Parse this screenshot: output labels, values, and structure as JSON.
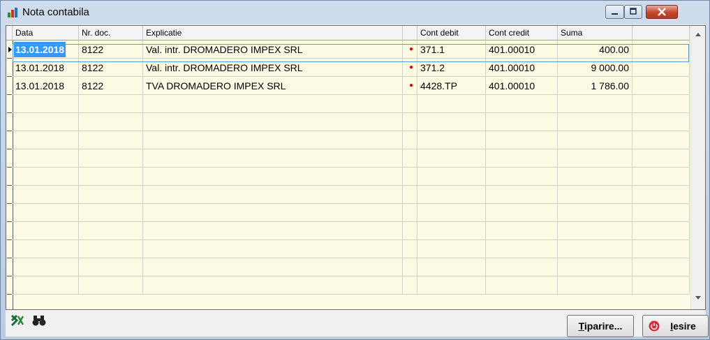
{
  "window": {
    "title": "Nota contabila"
  },
  "grid": {
    "headers": [
      "Data",
      "Nr. doc.",
      "Explicatie",
      "",
      "Cont debit",
      "Cont credit",
      "Suma"
    ],
    "rows": [
      {
        "date": "13.01.2018",
        "doc": "8122",
        "explicatie": "Val. intr. DROMADERO IMPEX SRL",
        "dot": "●",
        "debit": "371.1",
        "credit": "401.00010",
        "suma": "400.00"
      },
      {
        "date": "13.01.2018",
        "doc": "8122",
        "explicatie": "Val. intr. DROMADERO IMPEX SRL",
        "dot": "●",
        "debit": "371.2",
        "credit": "401.00010",
        "suma": "9 000.00"
      },
      {
        "date": "13.01.2018",
        "doc": "8122",
        "explicatie": "TVA DROMADERO IMPEX SRL",
        "dot": "●",
        "debit": "4428.TP",
        "credit": "401.00010",
        "suma": "1 786.00"
      }
    ],
    "selected_row": 0,
    "empty_row_count": 11
  },
  "toolbar": {
    "print_key": "T",
    "print_rest": "iparire...",
    "exit_key": "I",
    "exit_rest": "esire",
    "icons": [
      "excel-icon",
      "binoculars-icon",
      "power-icon"
    ]
  },
  "colors": {
    "grid_bg": "#fefbe5",
    "selection": "#3399ff",
    "status_dot": "#e00000",
    "close_button": "#c4452f"
  }
}
